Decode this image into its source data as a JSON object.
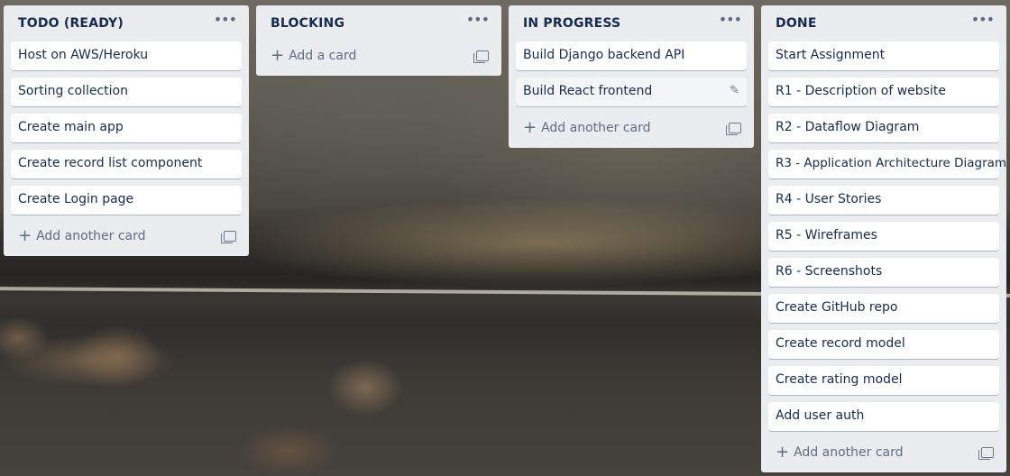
{
  "lists": [
    {
      "title": "TODO (READY)",
      "cards": [
        "Host on AWS/Heroku",
        "Sorting collection",
        "Create main app",
        "Create record list component",
        "Create Login page"
      ],
      "composer": "Add another card"
    },
    {
      "title": "BLOCKING",
      "cards": [],
      "composer": "Add a card"
    },
    {
      "title": "IN PROGRESS",
      "cards": [
        "Build Django backend API",
        "Build React frontend"
      ],
      "composer": "Add another card"
    },
    {
      "title": "DONE",
      "cards": [
        "Start Assignment",
        "R1 - Description of website",
        "R2 - Dataflow Diagram",
        "R3 - Application Architecture Diagram",
        "R4 - User Stories",
        "R5 - Wireframes",
        "R6 - Screenshots",
        "Create GitHub repo",
        "Create record model",
        "Create rating model",
        "Add user auth"
      ],
      "composer": "Add another card"
    }
  ],
  "icons": {
    "list_menu": "more-horizontal-icon",
    "add": "plus-icon",
    "template": "card-template-icon",
    "edit": "pencil-icon"
  },
  "colors": {
    "list_bg": "#ebecf0",
    "card_bg": "#ffffff",
    "text": "#172b4d",
    "muted": "#5e6c84"
  }
}
